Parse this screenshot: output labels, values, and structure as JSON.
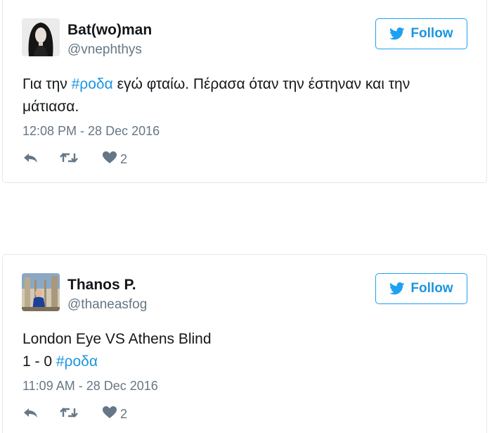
{
  "colors": {
    "link": "#1b95e0",
    "brand": "#1da1f2",
    "muted": "#657786",
    "text": "#14171a",
    "border": "#e1e8ed"
  },
  "tweets": [
    {
      "name": "Bat(wo)man",
      "handle": "@vnephthys",
      "follow_label": "Follow",
      "text_before": "Για την ",
      "hashtag": "#ροδα",
      "text_after": " εγώ φταίω. Πέρασα όταν την έστηναν και την μάτιασα.",
      "timestamp": "12:08 PM - 28 Dec 2016",
      "like_count": "2",
      "icons": [
        "reply-icon",
        "retweet-icon",
        "heart-icon",
        "twitter-bird-icon"
      ]
    },
    {
      "name": "Thanos P.",
      "handle": "@thaneasfog",
      "follow_label": "Follow",
      "line1": "London Eye VS Athens Blind",
      "line2_before": "1 - 0 ",
      "hashtag": "#ροδα",
      "timestamp": "11:09 AM - 28 Dec 2016",
      "like_count": "2",
      "icons": [
        "reply-icon",
        "retweet-icon",
        "heart-icon",
        "twitter-bird-icon"
      ]
    }
  ]
}
